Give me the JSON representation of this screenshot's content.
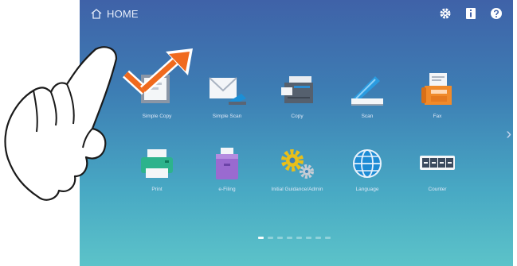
{
  "header": {
    "home_label": "HOME"
  },
  "tiles": [
    {
      "label": "Simple Copy",
      "icon": "copy-icon"
    },
    {
      "label": "Simple Scan",
      "icon": "scan-to-email-icon"
    },
    {
      "label": "Copy",
      "icon": "copier-icon"
    },
    {
      "label": "Scan",
      "icon": "scanner-icon"
    },
    {
      "label": "Fax",
      "icon": "fax-icon"
    },
    {
      "label": "Print",
      "icon": "printer-icon"
    },
    {
      "label": "e-Filing",
      "icon": "e-filing-icon"
    },
    {
      "label": "Initial Guidance/Admin",
      "icon": "settings-gears-icon"
    },
    {
      "label": "Language",
      "icon": "globe-icon"
    },
    {
      "label": "Counter",
      "icon": "counter-icon"
    }
  ],
  "pager": {
    "count": 8,
    "active": 1
  },
  "colors": {
    "gradient_top": "#3f62a8",
    "gradient_bottom": "#5cc3c9",
    "swipe_arrow": "#f06a1e"
  }
}
